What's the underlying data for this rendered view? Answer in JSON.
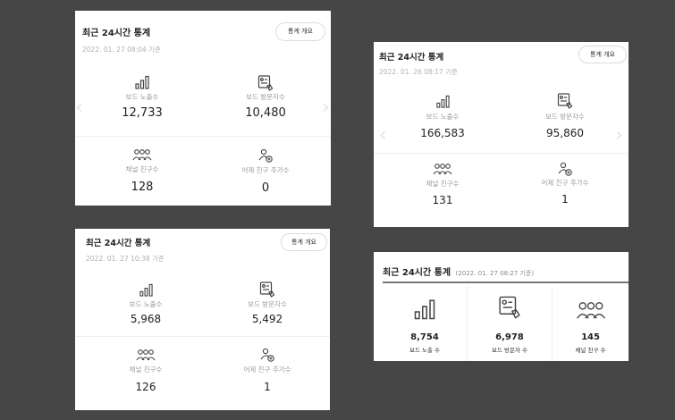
{
  "cards": [
    {
      "title": "최근 24시간 통계",
      "date": "2022. 01. 27 08:04 기준",
      "overview_button": "통계 개요",
      "stats": [
        {
          "label": "보드 노출수",
          "value": "12,733",
          "icon": "bar-chart-icon"
        },
        {
          "label": "보드 방문자수",
          "value": "10,480",
          "icon": "visitor-icon"
        },
        {
          "label": "채널 친구수",
          "value": "128",
          "icon": "friends-icon"
        },
        {
          "label": "어제 친구 추가수",
          "value": "0",
          "icon": "add-friend-icon"
        }
      ]
    },
    {
      "title": "최근 24시간 통계",
      "date": "2022. 01. 26 08:17 기준",
      "overview_button": "통계 개요",
      "stats": [
        {
          "label": "보드 노출수",
          "value": "166,583",
          "icon": "bar-chart-icon"
        },
        {
          "label": "보드 방문자수",
          "value": "95,860",
          "icon": "visitor-icon"
        },
        {
          "label": "채널 친구수",
          "value": "131",
          "icon": "friends-icon"
        },
        {
          "label": "어제 친구 추가수",
          "value": "1",
          "icon": "add-friend-icon"
        }
      ]
    },
    {
      "title": "최근 24시간 통계",
      "date": "2022. 01. 27 10:38 기준",
      "overview_button": "통계 개요",
      "stats": [
        {
          "label": "보드 노출수",
          "value": "5,968",
          "icon": "bar-chart-icon"
        },
        {
          "label": "보드 방문자수",
          "value": "5,492",
          "icon": "visitor-icon"
        },
        {
          "label": "채널 친구수",
          "value": "126",
          "icon": "friends-icon"
        },
        {
          "label": "어제 친구 추가수",
          "value": "1",
          "icon": "add-friend-icon"
        }
      ]
    },
    {
      "title": "최근 24시간 통계",
      "date": "(2022. 01. 27 08:27 기준)",
      "stats": [
        {
          "label": "보드 노출 수",
          "value": "8,754",
          "icon": "bar-chart-icon"
        },
        {
          "label": "보드 방문자 수",
          "value": "6,978",
          "icon": "visitor-icon"
        },
        {
          "label": "채널 친구 수",
          "value": "145",
          "icon": "friends-icon"
        }
      ]
    }
  ]
}
